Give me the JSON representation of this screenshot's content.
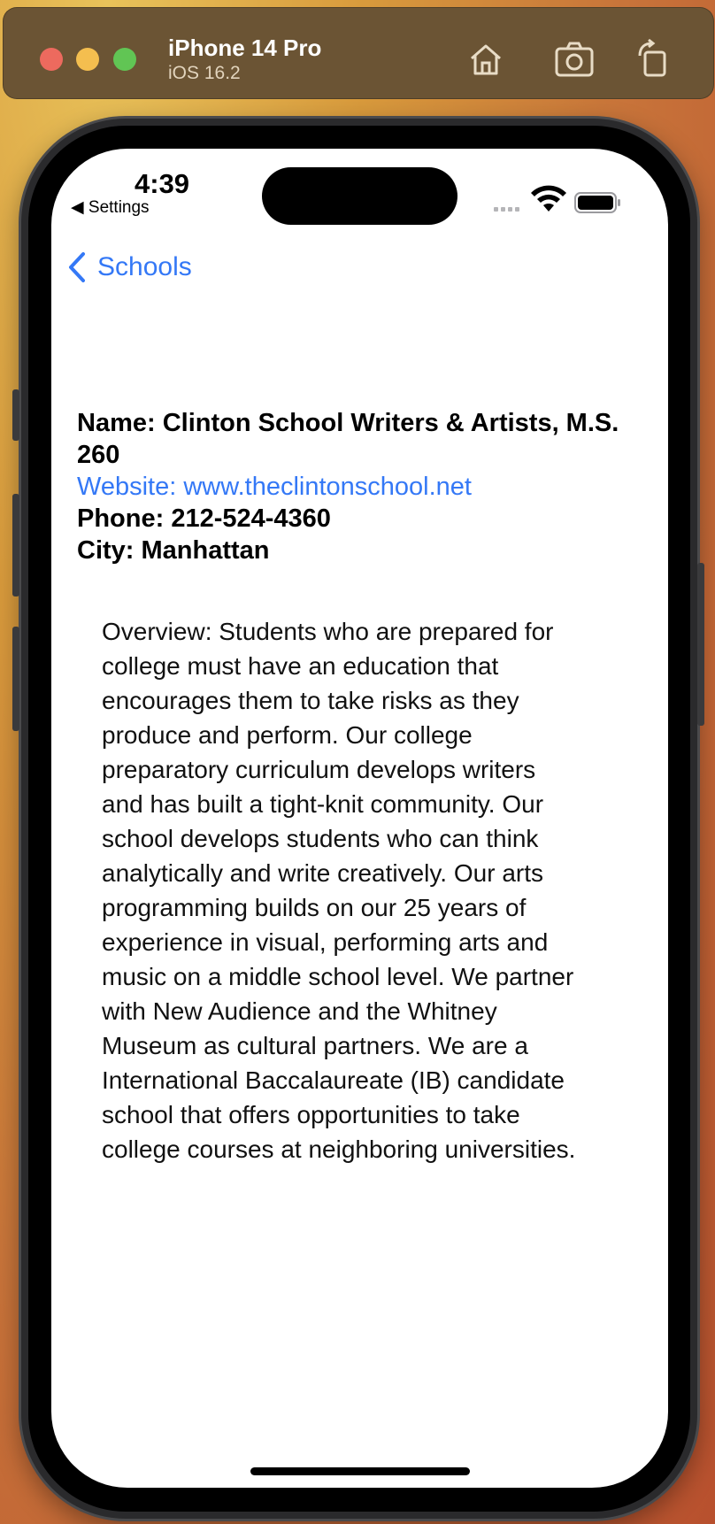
{
  "simulator": {
    "device_name": "iPhone 14 Pro",
    "os_version": "iOS 16.2",
    "buttons": [
      "home-icon",
      "screenshot-icon",
      "rotate-icon"
    ]
  },
  "status_bar": {
    "time": "4:39",
    "back_app": "◀ Settings"
  },
  "nav": {
    "back_label": "Schools"
  },
  "school": {
    "name": "Name: Clinton School Writers & Artists, M.S. 260",
    "website": "Website: www.theclintonschool.net",
    "phone": "Phone: 212-524-4360",
    "city": "City: Manhattan",
    "overview": "Overview: Students who are prepared for\ncollege must have an education that\nencourages them to take risks as they\nproduce and perform. Our college\npreparatory curriculum develops writers\nand has built a tight-knit community. Our\nschool develops students who can think\nanalytically and write creatively. Our arts\nprogramming builds on our 25 years of\nexperience in visual, performing arts and\nmusic on a middle school level. We partner\nwith New Audience and the Whitney\nMuseum as cultural partners. We are a\nInternational Baccalaureate (IB) candidate\nschool that offers opportunities to take\ncollege courses at neighboring universities."
  },
  "colors": {
    "accent": "#3478f6",
    "sim_bar": "#6b5434"
  }
}
